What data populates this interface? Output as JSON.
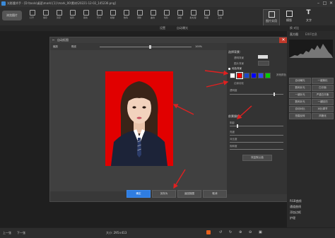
{
  "window": {
    "title": "光影魔术手 - [D:\\tools\\桌面\\mark\\{1}\\mark_00\\素材\\20221-12-02_145236.png]",
    "min": "–",
    "max": "□",
    "close": "✕"
  },
  "toolbar": {
    "open_label": "浏览图片",
    "tools": [
      "打开",
      "保存",
      "另存",
      "旋转",
      "裁剪",
      "尺寸",
      "模糊",
      "数码",
      "调整",
      "曲线",
      "色阶",
      "边框",
      "批处理",
      "拼图",
      "工具"
    ],
    "right_tools": [
      "图片实用",
      "模版",
      "文字"
    ]
  },
  "subbar": {
    "left": "设置",
    "center": "自动曝光",
    "right": "换 对比"
  },
  "dialog": {
    "title": "自动抠图",
    "zoom_label": "缩放",
    "zoom_value": "100%",
    "tool_label": "橡皮",
    "panel": {
      "bg_section": "选择背景：",
      "bg_transparent": "透明背景",
      "bg_image": "图片背景",
      "bg_fill_label": "纯色背景",
      "colors": [
        "#ffffff",
        "#ff0000",
        "#1a47c9",
        "#0000ff",
        "#3344ff",
        "#00cc00"
      ],
      "more_colors": "其他颜色",
      "edge_soften": "边缘羽化",
      "opacity": "透明度",
      "bg_op_section": "前景操作：",
      "op_shadow": "阴影",
      "op_brightness": "亮度",
      "op_contrast": "对比度",
      "op_saturation": "饱和度",
      "reset_btn": "恢复默认值"
    },
    "buttons": {
      "ok": "确定",
      "save_as": "另存为",
      "back": "返回抠图",
      "cancel": "取消"
    }
  },
  "rpanel": {
    "tabs": [
      "直方图",
      "EXIF信息"
    ],
    "rows": [
      "自动曝光",
      "一键美化",
      "数码补光",
      "白平衡",
      "一键补光",
      "严重白平衡",
      "数码补光",
      "一键回归",
      "自动对比",
      "对比调节",
      "拍摄反转",
      "风格化"
    ],
    "sections": [
      "RGB曲线",
      "通道曲线",
      "添加边框",
      "护理"
    ]
  },
  "status": {
    "left": "上一张",
    "prev": "下一张",
    "info": "大小: 295×413"
  }
}
